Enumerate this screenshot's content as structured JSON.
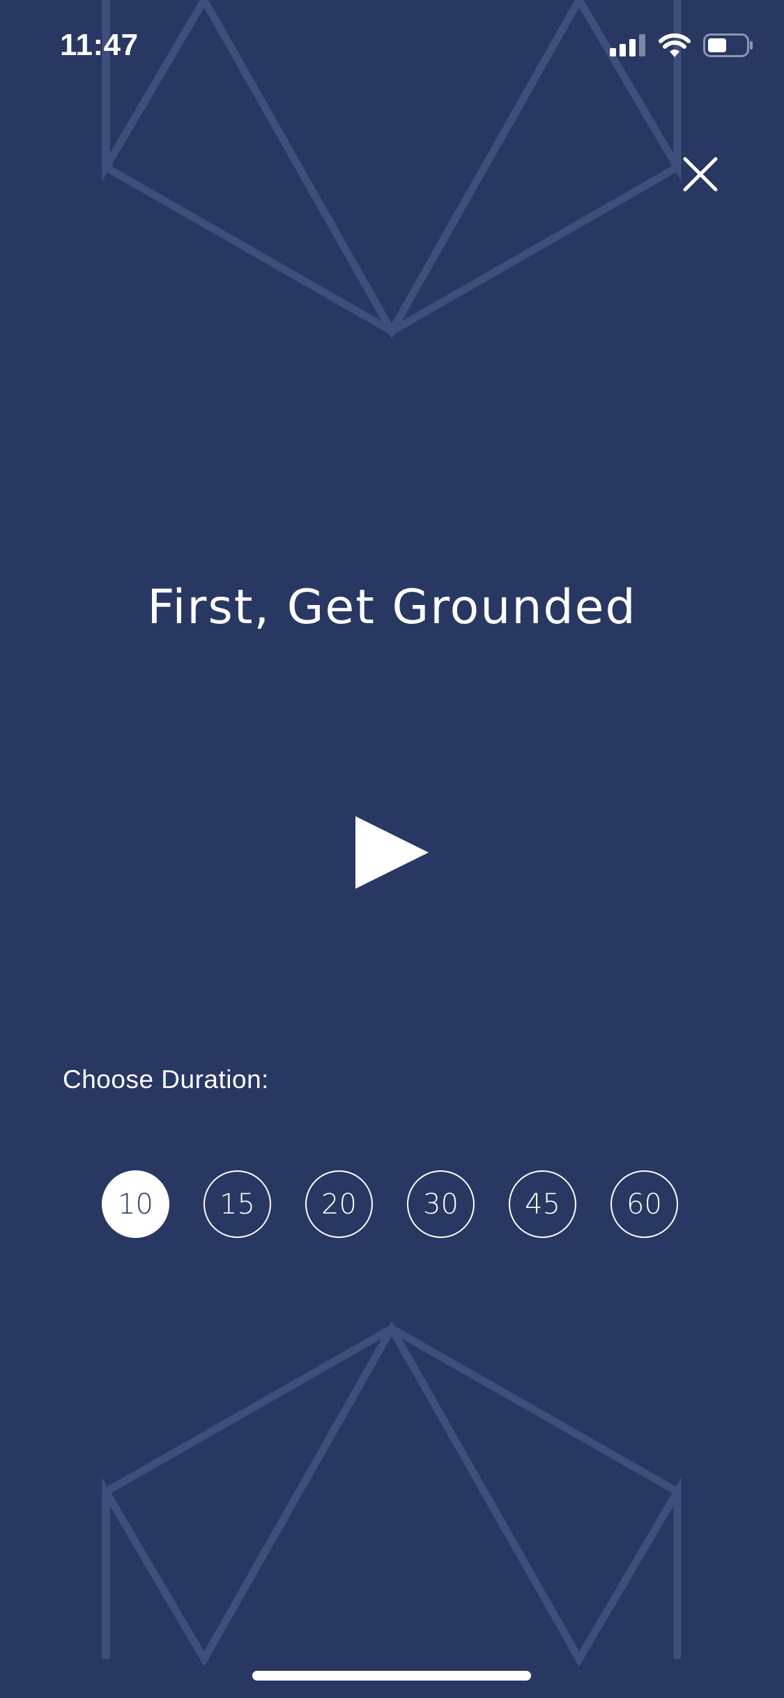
{
  "status_bar": {
    "time": "11:47",
    "icons": [
      "cellular-signal-icon",
      "wifi-icon",
      "battery-icon"
    ]
  },
  "header": {
    "close_icon": "close-icon"
  },
  "main": {
    "title": "First, Get Grounded",
    "play_icon": "play-icon"
  },
  "duration": {
    "label": "Choose Duration:",
    "options": [
      "10",
      "15",
      "20",
      "30",
      "45",
      "60"
    ],
    "selected": "10"
  },
  "colors": {
    "background": "#293763",
    "pattern": "#3f4f7d",
    "foreground": "#ffffff"
  }
}
